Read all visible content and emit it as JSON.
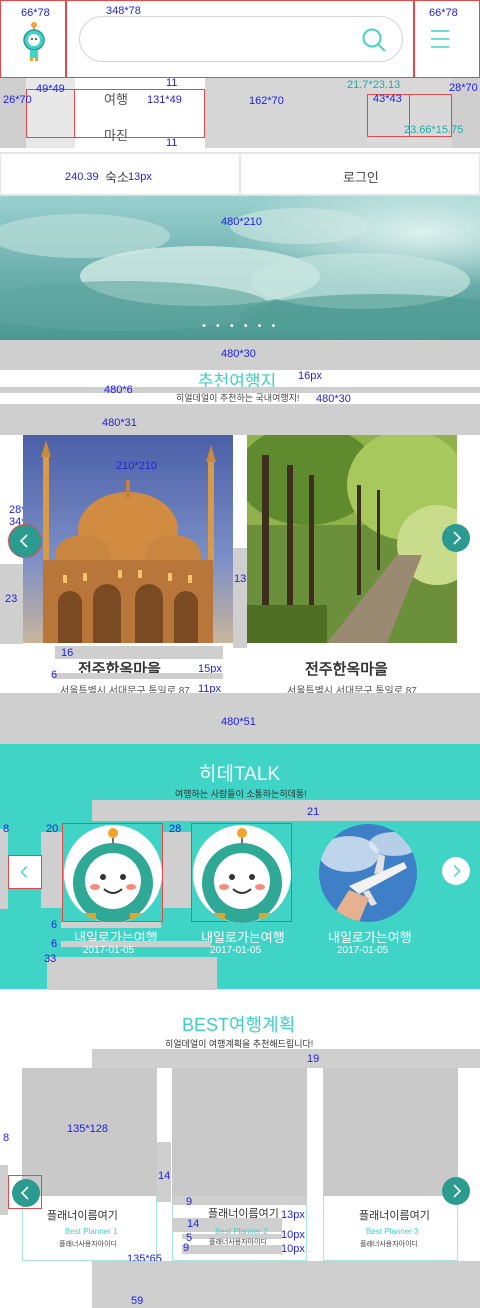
{
  "header": {
    "nav_primary": "여행",
    "nav_secondary": "마진",
    "search_placeholder": "",
    "login_left": "숙소",
    "login_right": "로그인",
    "notes": {
      "logo_box": "66*78",
      "search_box": "348*78",
      "menu_box": "66*78",
      "row_height": "26*70",
      "tab_box": "49*49",
      "tab_wide": "131*49",
      "middle": "162*70",
      "right_icon": "21.7*23.13",
      "right_box": "28*70",
      "small_box": "43*43",
      "small_dim": "23.66*15.75",
      "gap_11a": "11",
      "gap_11b": "11",
      "login_width": "240.39",
      "login_size": "13px"
    }
  },
  "hero": {
    "size_note": "480*210",
    "dots": [
      "•",
      "•",
      "•",
      "•",
      "•",
      "•"
    ],
    "gap_note": "480*30"
  },
  "recommend": {
    "title": "추천여행지",
    "subtitle": "히얼데얼이 추천하는 국내여행지!",
    "notes": {
      "title_font": "16px",
      "gap_6": "480*6",
      "gap_30": "480*30",
      "gap_31": "480*31",
      "img_size": "210*210",
      "arrow_box": "28*28",
      "arrow_size": "34*34",
      "side_gap": "23",
      "num_13": "13",
      "num_16": "16",
      "num_6": "6",
      "font_15": "15px",
      "font_11": "11px",
      "bottom_gap": "480*51"
    },
    "cards": [
      {
        "name": "전주한옥마을",
        "address": "서울특별시 서대문구 통일로 87"
      },
      {
        "name": "전주한옥마을",
        "address": "서울특별시 서대문구 통일로 87"
      }
    ]
  },
  "talk": {
    "title": "히데TALK",
    "subtitle": "여행하는 사람들이 소통하는히데통!",
    "notes": {
      "gap_21": "21",
      "n8": "8",
      "n20": "20",
      "n28": "28",
      "n6a": "6",
      "n6b": "6",
      "n33": "33"
    },
    "items": [
      {
        "name": "내일로가는여행",
        "date": "2017-01-05"
      },
      {
        "name": "내일로가는여행",
        "date": "2017-01-05"
      },
      {
        "name": "내일로가는여행",
        "date": "2017-01-05"
      }
    ]
  },
  "best": {
    "title": "BEST여행계획",
    "subtitle": "히얼데얼이 여행계획을 추천해드립니다!",
    "notes": {
      "n19": "19",
      "n8": "8",
      "img": "135*128",
      "n14": "14",
      "n9a": "9",
      "n14b": "14",
      "n5": "5",
      "n9b": "9",
      "f13": "13px",
      "f10a": "10px",
      "f10b": "10px",
      "card": "135*65",
      "n59": "59"
    },
    "cards": [
      {
        "name": "플래너이름여기",
        "planner": "Best Planner 1",
        "user": "플래너사용자아이디"
      },
      {
        "name": "플래너이름여기",
        "planner": "Best Planner 2",
        "user": "플래너사용자아이디"
      },
      {
        "name": "플래너이름여기",
        "planner": "Best Planner 3",
        "user": "플래너사용자아이디"
      }
    ]
  },
  "colors": {
    "teal": "#3fd4c6",
    "teal_dark": "#2a9b8e",
    "annotation": "#2222dd",
    "guide": "#e04a4a",
    "gray": "#cfcfcf"
  }
}
